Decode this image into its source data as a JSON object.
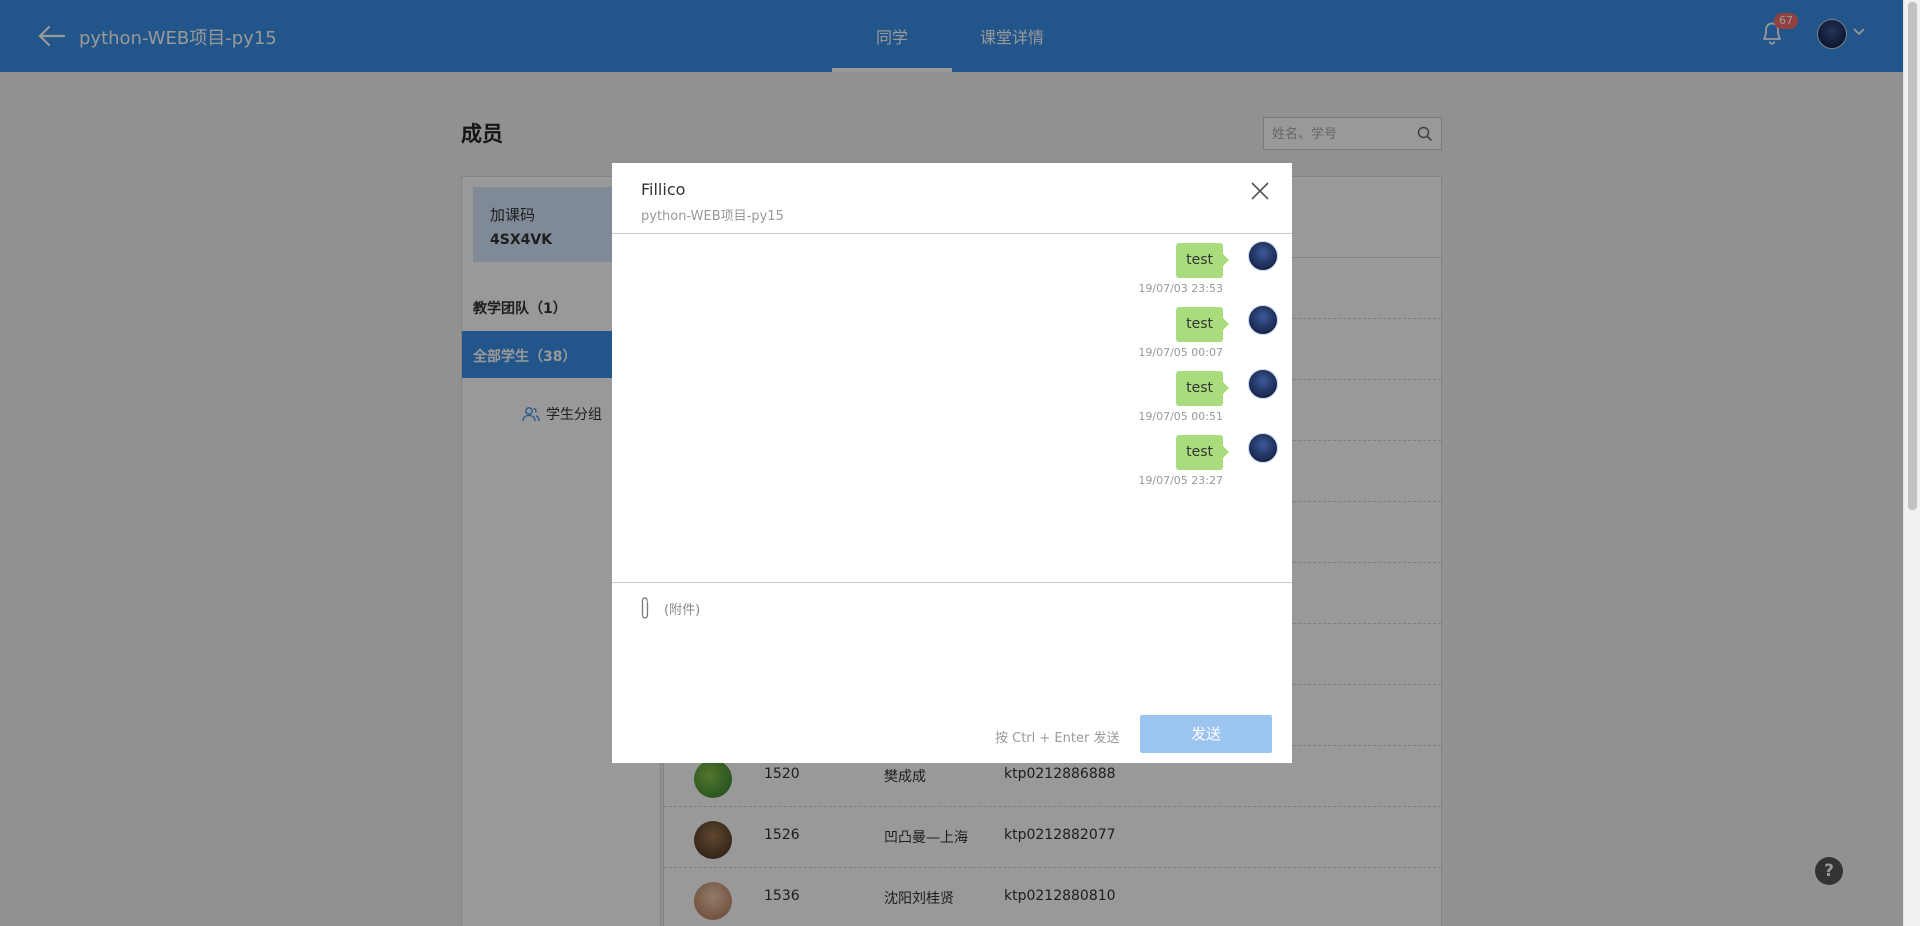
{
  "header": {
    "course_title": "python-WEB项目-py15",
    "tabs": [
      {
        "label": "同学"
      },
      {
        "label": "课堂详情"
      }
    ],
    "notification_count": "67"
  },
  "page": {
    "heading": "成员",
    "search_placeholder": "姓名、学号"
  },
  "sidebar": {
    "code_label": "加课码",
    "code_value": "4SX4VK",
    "team_label": "教学团队（1）",
    "all_students_label": "全部学生（38）",
    "group_label": "学生分组"
  },
  "students": [
    {
      "number": "1520",
      "name": "樊成成",
      "id": "ktp0212886888",
      "avatar_color": "#4caf50"
    },
    {
      "number": "1526",
      "name": "凹凸曼—上海",
      "id": "ktp0212882077",
      "avatar_color": "#7a5a3a"
    },
    {
      "number": "1536",
      "name": "沈阳刘桂贤",
      "id": "ktp0212880810",
      "avatar_color": "#d9b48f"
    }
  ],
  "dialog": {
    "contact_name": "Fillico",
    "course": "python-WEB项目-py15",
    "messages": [
      {
        "text": "test",
        "time": "19/07/03 23:53"
      },
      {
        "text": "test",
        "time": "19/07/05 00:07"
      },
      {
        "text": "test",
        "time": "19/07/05 00:51"
      },
      {
        "text": "test",
        "time": "19/07/05 23:27"
      }
    ],
    "attach_label": "(附件)",
    "hint": "按 Ctrl + Enter 发送",
    "send_label": "发送"
  },
  "help_label": "?",
  "colors": {
    "brand": "#3a8ee6",
    "bubble": "#a8dc7c",
    "badge": "#f56c6c",
    "send_disabled": "#9cc4f0"
  }
}
